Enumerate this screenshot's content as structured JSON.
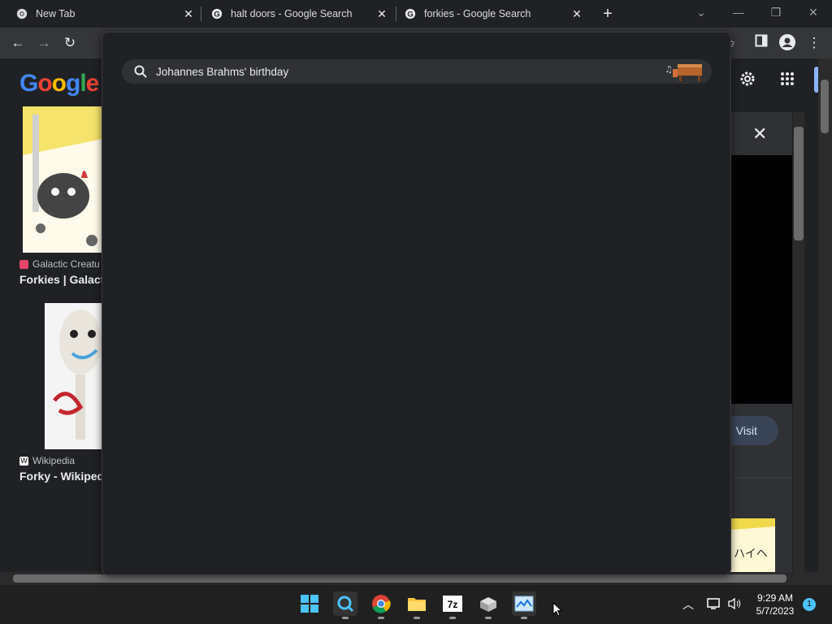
{
  "browser": {
    "tabs": [
      {
        "title": "New Tab",
        "type": "chrome"
      },
      {
        "title": "halt doors - Google Search",
        "type": "google"
      },
      {
        "title": "forkies - Google Search",
        "type": "google",
        "active": true
      }
    ],
    "toolbar_icons": [
      "back-icon",
      "forward-icon",
      "reload-icon",
      "extensions-icon",
      "side-panel-icon",
      "profile-icon",
      "menu-icon"
    ]
  },
  "omnibox": {
    "query": "Johannes Brahms' birthday"
  },
  "page": {
    "logo": "Google",
    "results": [
      {
        "source": "Galactic Creatu",
        "title": "Forkies | Galacti"
      },
      {
        "source": "Wikipedia",
        "title": "Forky - Wikipedi"
      }
    ],
    "panel": {
      "visit_label": "Visit"
    }
  },
  "taskbar": {
    "apps": [
      "windows-start-icon",
      "search-icon",
      "chrome-icon",
      "file-explorer-icon",
      "7zip-icon",
      "app-icon",
      "photo-app-icon"
    ],
    "time": "9:29 AM",
    "date": "5/7/2023",
    "notification_count": "1"
  },
  "colors": {
    "background": "#202124",
    "toolbar": "#35363a",
    "omnibox": "#303134",
    "accent": "#8ab4f8"
  }
}
